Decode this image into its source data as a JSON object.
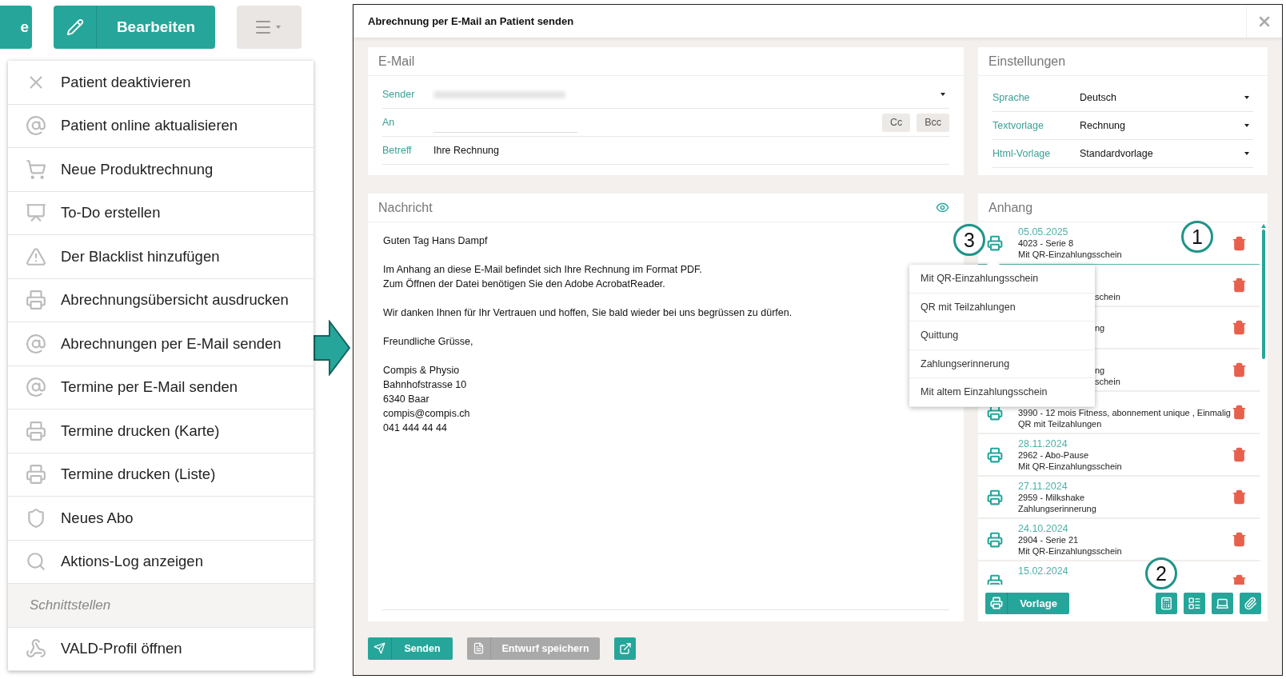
{
  "toolbar": {
    "cut_button": "e",
    "edit_button": "Bearbeiten"
  },
  "menu": [
    {
      "kind": "item",
      "label": "Patient deaktivieren"
    },
    {
      "kind": "item",
      "label": "Patient online aktualisieren"
    },
    {
      "kind": "item",
      "label": "Neue Produktrechnung"
    },
    {
      "kind": "item",
      "label": "To-Do erstellen"
    },
    {
      "kind": "item",
      "label": "Der Blacklist hinzufügen"
    },
    {
      "kind": "item",
      "label": "Abrechnungsübersicht ausdrucken"
    },
    {
      "kind": "item",
      "label": "Abrechnungen per E-Mail senden"
    },
    {
      "kind": "item",
      "label": "Termine per E-Mail senden"
    },
    {
      "kind": "item",
      "label": "Termine drucken (Karte)"
    },
    {
      "kind": "item",
      "label": "Termine drucken (Liste)"
    },
    {
      "kind": "item",
      "label": "Neues Abo"
    },
    {
      "kind": "item",
      "label": "Aktions-Log anzeigen"
    },
    {
      "kind": "section",
      "label": "Schnittstellen"
    },
    {
      "kind": "item",
      "label": "VALD-Profil öffnen"
    }
  ],
  "dialog": {
    "title": "Abrechnung per E-Mail an Patient senden",
    "email": {
      "heading": "E-Mail",
      "fields": [
        {
          "kind": "select",
          "label": "Sender"
        },
        {
          "kind": "recipients",
          "label": "An",
          "buttons": [
            "Cc",
            "Bcc"
          ]
        },
        {
          "kind": "text",
          "label": "Betreff",
          "value": "Ihre Rechnung"
        }
      ]
    },
    "settings": {
      "heading": "Einstellungen",
      "fields": [
        {
          "label": "Sprache",
          "value": "Deutsch"
        },
        {
          "label": "Textvorlage",
          "value": "Rechnung"
        },
        {
          "label": "Html-Vorlage",
          "value": "Standardvorlage"
        }
      ]
    },
    "message": {
      "heading": "Nachricht",
      "paragraphs": [
        [
          "Guten Tag Hans Dampf"
        ],
        [
          "Im Anhang an diese E-Mail befindet sich Ihre Rechnung im Format PDF.",
          "Zum Öffnen der Datei benötigen Sie den Adobe AcrobatReader."
        ],
        [
          "Wir danken Ihnen für Ihr Vertrauen und hoffen, Sie bald wieder bei uns begrüssen zu dürfen."
        ],
        [
          "Freundliche Grüsse,"
        ],
        [
          "Compis & Physio",
          "Bahnhofstrasse 10",
          "6340 Baar",
          "compis@compis.ch",
          "041 444 44 44"
        ]
      ]
    },
    "attachments": {
      "heading": "Anhang",
      "rows": [
        {
          "kind": "full",
          "selected": true,
          "date": "05.05.2025",
          "title": "4023 - Serie 8",
          "type": "Mit QR-Einzahlungsschein"
        },
        {
          "kind": "covered",
          "selected": false,
          "type_tail": "schein"
        },
        {
          "kind": "covered",
          "selected": false,
          "title_tail": "ng"
        },
        {
          "kind": "covered",
          "selected": false,
          "title_tail": "ng",
          "type_tail": "schein"
        },
        {
          "kind": "full",
          "selected": false,
          "title": "3990 - 12 mois Fitness, abonnement unique , Einmalig",
          "type": "QR mit Teilzahlungen"
        },
        {
          "kind": "full",
          "selected": false,
          "date": "28.11.2024",
          "title": "2962 - Abo-Pause",
          "type": "Mit QR-Einzahlungsschein"
        },
        {
          "kind": "full",
          "selected": false,
          "date": "27.11.2024",
          "title": "2959 - Milkshake",
          "type": "Zahlungserinnerung"
        },
        {
          "kind": "full",
          "selected": false,
          "date": "24.10.2024",
          "title": "2904 - Serie 21",
          "type": "Mit QR-Einzahlungsschein"
        },
        {
          "kind": "full",
          "selected": false,
          "date": "15.02.2024"
        }
      ],
      "template_button": "Vorlage"
    },
    "print_menu": [
      "Mit QR-Einzahlungsschein",
      "QR mit Teilzahlungen",
      "Quittung",
      "Zahlungserinnerung",
      "Mit altem Einzahlungsschein"
    ],
    "footer": {
      "send_button": "Senden",
      "draft_button": "Entwurf speichern"
    }
  },
  "callouts": [
    "1",
    "2",
    "3"
  ]
}
